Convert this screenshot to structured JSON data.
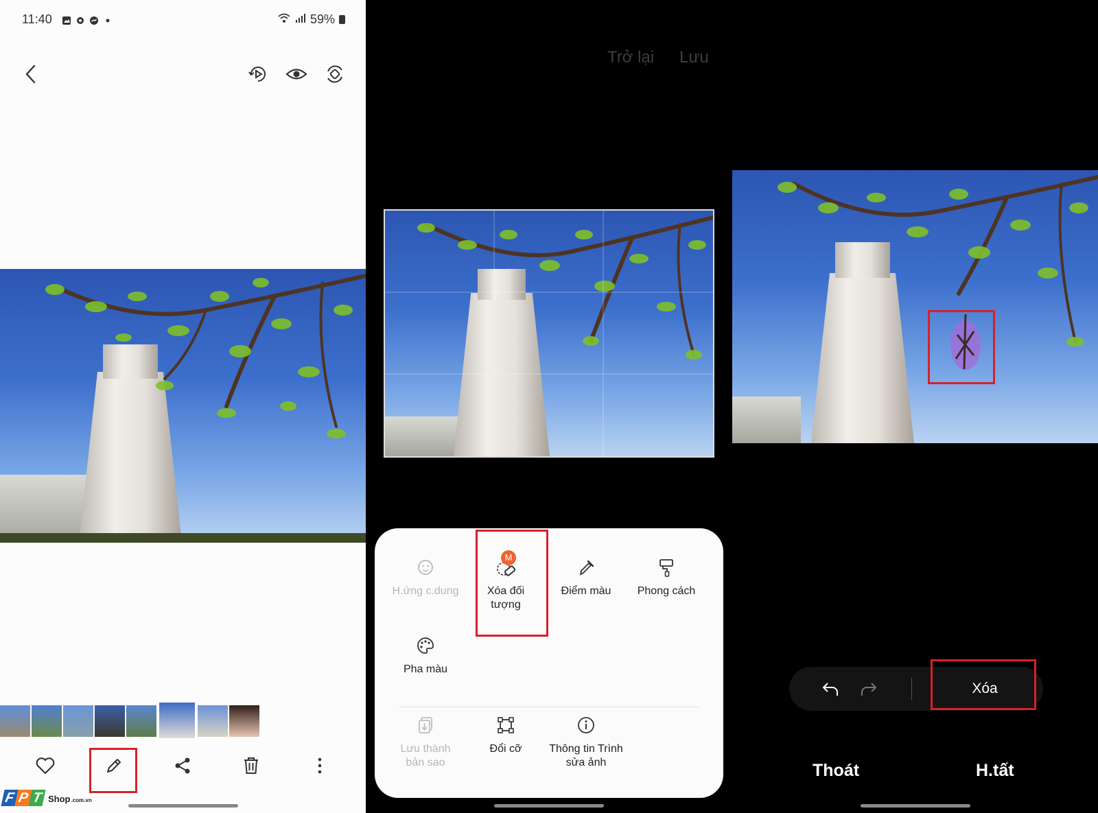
{
  "status_bar": {
    "time": "11:40",
    "battery": "59%"
  },
  "editor_header": {
    "back": "Trở lại",
    "save": "Lưu"
  },
  "tools": {
    "portrait_effect": "H.ứng c.dung",
    "object_eraser": "Xóa đối tượng",
    "object_eraser_badge": "M",
    "color_point": "Điểm màu",
    "style": "Phong cách",
    "color_mix": "Pha màu",
    "save_copy": "Lưu thành bản sao",
    "resize": "Đổi cỡ",
    "editor_info": "Thông tin Trình sửa ảnh"
  },
  "eraser_bar": {
    "erase": "Xóa"
  },
  "eraser_footer": {
    "exit": "Thoát",
    "done": "H.tất"
  },
  "watermark": {
    "brand": "FPT",
    "shop": "Shop",
    "domain": ".com.vn"
  },
  "colors": {
    "highlight": "#d6212a",
    "fpt_blue": "#1f5fb7",
    "fpt_orange": "#f47a20",
    "fpt_green": "#3cab4a"
  }
}
